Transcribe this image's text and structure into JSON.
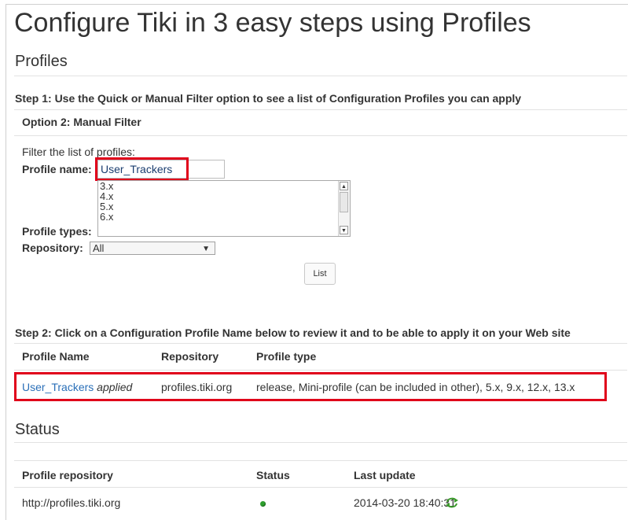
{
  "page": {
    "title": "Configure Tiki in 3 easy steps using Profiles",
    "profiles_heading": "Profiles"
  },
  "step1": {
    "heading": "Step 1: Use the Quick or Manual Filter option to see a list of Configuration Profiles you can apply",
    "option_heading": "Option 2: Manual Filter",
    "filter_intro": "Filter the list of profiles:",
    "profile_name_label": "Profile name:",
    "profile_name_value": "User_Trackers",
    "profile_types_label": "Profile types:",
    "profile_types_options": [
      "3.x",
      "4.x",
      "5.x",
      "6.x"
    ],
    "repository_label": "Repository:",
    "repository_value": "All",
    "list_button": "List"
  },
  "step2": {
    "heading": "Step 2: Click on a Configuration Profile Name below to review it and to be able to apply it on your Web site",
    "columns": [
      "Profile Name",
      "Repository",
      "Profile type"
    ],
    "row": {
      "name": "User_Trackers",
      "applied": "applied",
      "repository": "profiles.tiki.org",
      "type": "release, Mini-profile (can be included in other), 5.x, 9.x, 12.x, 13.x"
    }
  },
  "status": {
    "heading": "Status",
    "columns": [
      "Profile repository",
      "Status",
      "Last update"
    ],
    "row": {
      "repository": "http://profiles.tiki.org",
      "status_icon": "green-dot-icon",
      "last_update": "2014-03-20 18:40:31",
      "refresh_icon": "refresh-icon"
    }
  },
  "colors": {
    "highlight": "#e0001a",
    "link": "#2a6fb8",
    "status_ok": "#2e9e2e"
  }
}
